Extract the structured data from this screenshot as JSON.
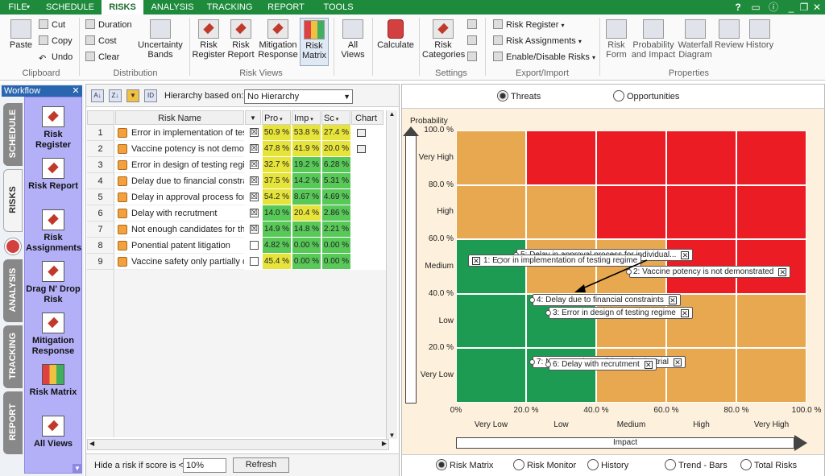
{
  "menu": {
    "file": "FILE",
    "tabs": [
      "SCHEDULE",
      "RISKS",
      "ANALYSIS",
      "TRACKING",
      "REPORT",
      "TOOLS"
    ],
    "active_tab": "RISKS",
    "help": "?",
    "right_icons": [
      "feedback-icon",
      "info-icon",
      "minimize-icon",
      "restore-icon"
    ]
  },
  "ribbon": {
    "clipboard": {
      "paste": "Paste",
      "cut": "Cut",
      "copy": "Copy",
      "undo": "Undo",
      "label": "Clipboard"
    },
    "distribution": {
      "duration": "Duration",
      "cost": "Cost",
      "clear": "Clear",
      "uncertainty": "Uncertainty Bands",
      "label": "Distribution"
    },
    "risk_views": {
      "register": "Risk Register",
      "report": "Risk Report",
      "mitigation": "Mitigation Response",
      "matrix": "Risk Matrix",
      "label": "Risk Views"
    },
    "all_views": "All Views",
    "calculate": "Calculate",
    "settings": {
      "categories": "Risk Categories",
      "label": "Settings"
    },
    "export": {
      "register": "Risk Register",
      "assignments": "Risk Assignments",
      "enable": "Enable/Disable Risks",
      "label": "Export/Import"
    },
    "properties": {
      "form": "Risk Form",
      "prob_impact": "Probability and Impact",
      "waterfall": "Waterfall Diagram",
      "review": "Review",
      "history": "History",
      "label": "Properties"
    }
  },
  "workflow": {
    "title": "Workflow",
    "tabs": [
      "SCHEDULE",
      "RISKS",
      "ANALYSIS",
      "TRACKING",
      "REPORT"
    ],
    "items": [
      "Risk Register",
      "Risk Report",
      "Risk Assignments",
      "Drag N' Drop Risk",
      "Mitigation Response",
      "Risk Matrix",
      "All Views"
    ]
  },
  "grid": {
    "hierarchy_label": "Hierarchy based on:",
    "hierarchy_value": "No Hierarchy",
    "columns": {
      "name": "Risk Name",
      "pr": "Pro",
      "im": "Imp",
      "sc": "Sc",
      "chart": "Chart"
    },
    "rows": [
      {
        "num": "1",
        "name": "Error in implementation of testing",
        "checked": "☒",
        "pr": "50.9 %",
        "im": "53.8 %",
        "sc": "27.4 %"
      },
      {
        "num": "2",
        "name": "Vaccine potency is not demonst",
        "checked": "☒",
        "pr": "47.8 %",
        "im": "41.9 %",
        "sc": "20.0 %"
      },
      {
        "num": "3",
        "name": "Error in design of testing regime",
        "checked": "☒",
        "pr": "32.7 %",
        "im": "19.2 %",
        "sc": "6.28 %"
      },
      {
        "num": "4",
        "name": "Delay due to financial constrain",
        "checked": "☒",
        "pr": "37.5 %",
        "im": "14.2 %",
        "sc": "5.31 %"
      },
      {
        "num": "5",
        "name": "Delay in approval process for ir",
        "checked": "☒",
        "pr": "54.2 %",
        "im": "8.67 %",
        "sc": "4.69 %"
      },
      {
        "num": "6",
        "name": "Delay with recrutment",
        "checked": "☒",
        "pr": "14.0 %",
        "im": "20.4 %",
        "sc": "2.86 %"
      },
      {
        "num": "7",
        "name": "Not enough candidates for the t",
        "checked": "☒",
        "pr": "14.9 %",
        "im": "14.8 %",
        "sc": "2.21 %"
      },
      {
        "num": "8",
        "name": "Ponential patent litigation",
        "checked": "",
        "pr": "4.82 %",
        "im": "0.00 %",
        "sc": "0.00 %"
      },
      {
        "num": "9",
        "name": "Vaccine safety only partially de",
        "checked": "",
        "pr": "45.4 %",
        "im": "0.00 %",
        "sc": "0.00 %"
      }
    ],
    "hide_label": "Hide a risk if score is <",
    "hide_value": "10%",
    "refresh": "Refresh"
  },
  "chart_top": {
    "threats": "Threats",
    "opportunities": "Opportunities"
  },
  "chart_bottom": [
    "Risk Matrix",
    "Risk Monitor",
    "History",
    "Trend - Bars",
    "Total Risks"
  ],
  "chart_data": {
    "type": "heatmap",
    "ylabel": "Probability",
    "xlabel": "Impact",
    "y_ticks": [
      "0%",
      "20.0 %",
      "40.0 %",
      "60.0 %",
      "80.0 %",
      "100.0 %"
    ],
    "x_ticks": [
      "0%",
      "20.0 %",
      "40.0 %",
      "60.0 %",
      "80.0 %",
      "100.0 %"
    ],
    "y_categories": [
      "Very Low",
      "Low",
      "Medium",
      "High",
      "Very High"
    ],
    "x_categories": [
      "Very Low",
      "Low",
      "Medium",
      "High",
      "Very High"
    ],
    "colors": {
      "green": "#1e9b52",
      "orange": "#e8a850",
      "red": "#ec1c24"
    },
    "cells": [
      [
        "green",
        "green",
        "orange",
        "orange",
        "orange"
      ],
      [
        "green",
        "green",
        "orange",
        "orange",
        "orange"
      ],
      [
        "green",
        "orange",
        "orange",
        "red",
        "red"
      ],
      [
        "orange",
        "orange",
        "red",
        "red",
        "red"
      ],
      [
        "orange",
        "red",
        "red",
        "red",
        "red"
      ]
    ],
    "risks": [
      {
        "label": "5: Delay in approval process for individual...",
        "impact": 8.67,
        "probability": 54.2
      },
      {
        "label": "2: Vaccine potency is not demonstrated",
        "impact": 41.9,
        "probability": 47.8
      },
      {
        "label": "1: Error in implementation of testing regime",
        "impact": 53.8,
        "probability": 50.9
      },
      {
        "label": "4: Delay due to financial constraints",
        "impact": 14.2,
        "probability": 37.5
      },
      {
        "label": "3: Error in design of testing regime",
        "impact": 19.2,
        "probability": 32.7
      },
      {
        "label": "7: Not enough candidates for the trial",
        "impact": 14.8,
        "probability": 14.9
      },
      {
        "label": "6: Delay with recrutment",
        "impact": 20.4,
        "probability": 14.0
      }
    ]
  }
}
